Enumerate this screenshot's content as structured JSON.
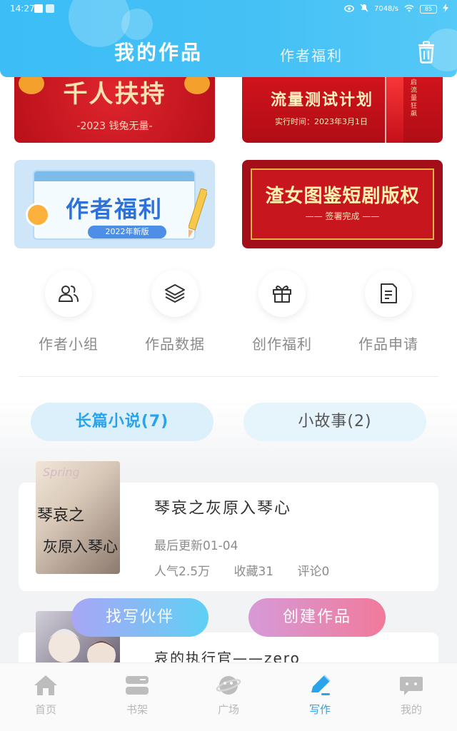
{
  "status_bar": {
    "time": "14:27",
    "network_speed": "7048/s",
    "battery": "85"
  },
  "header": {
    "tab_active": "我的作品",
    "tab_other": "作者福利",
    "trash_icon": "trash-icon"
  },
  "banners": [
    {
      "main": "千人扶持",
      "sub": "-2023 钱兔无量-"
    },
    {
      "main": "流量测试计划",
      "sub": "实行时间：2023年3月1日",
      "side": "开启流量狂飙"
    },
    {
      "main": "作者福利",
      "sub": "2022年新版"
    },
    {
      "main": "渣女图鉴短剧版权",
      "sub": "—— 签署完成 ——"
    }
  ],
  "quick_actions": [
    {
      "label": "作者小组",
      "icon": "users-icon"
    },
    {
      "label": "作品数据",
      "icon": "layers-icon"
    },
    {
      "label": "创作福利",
      "icon": "gift-icon"
    },
    {
      "label": "作品申请",
      "icon": "document-icon"
    }
  ],
  "categories": [
    {
      "label": "长篇小说(7)",
      "active": true
    },
    {
      "label": "小故事(2)",
      "active": false
    }
  ],
  "works": [
    {
      "title": "琴哀之灰原入琴心",
      "updated": "最后更新01-04",
      "popularity": "人气2.5万",
      "favorites": "收藏31",
      "comments": "评论0",
      "cover_line1": "琴哀之",
      "cover_line2": "灰原入琴心",
      "cover_word": "Spring"
    },
    {
      "title": "哀的执行官——zero"
    }
  ],
  "floating_buttons": {
    "find_partner": "找写伙伴",
    "create_work": "创建作品"
  },
  "bottom_nav": [
    {
      "label": "首页",
      "icon": "home-icon",
      "active": false
    },
    {
      "label": "书架",
      "icon": "bookshelf-icon",
      "active": false
    },
    {
      "label": "广场",
      "icon": "planet-icon",
      "active": false
    },
    {
      "label": "写作",
      "icon": "pen-icon",
      "active": true
    },
    {
      "label": "我的",
      "icon": "chat-bubble-icon",
      "active": false
    }
  ],
  "colors": {
    "accent": "#2aa3ea",
    "header": "#46c1f5",
    "banner_red": "#c8161f"
  }
}
